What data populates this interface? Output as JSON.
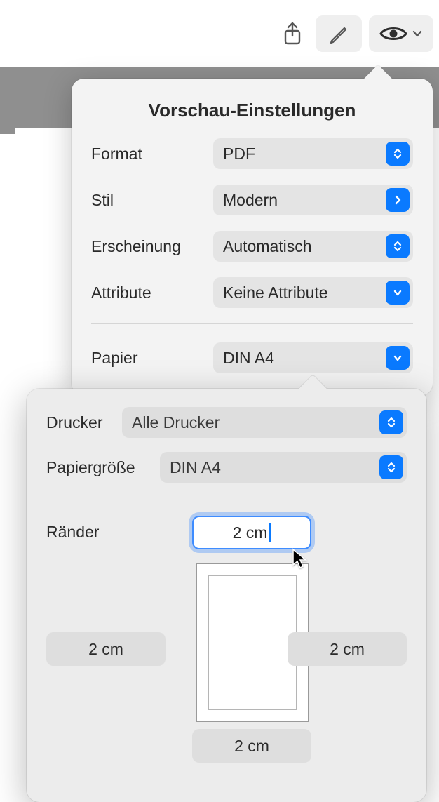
{
  "toolbar": {
    "share_icon": "share-icon",
    "edit_icon": "pencil-icon",
    "preview_icon": "eye-icon"
  },
  "panel": {
    "title": "Vorschau-Einstellungen",
    "rows": {
      "format": {
        "label": "Format",
        "value": "PDF"
      },
      "style": {
        "label": "Stil",
        "value": "Modern"
      },
      "appearance": {
        "label": "Erscheinung",
        "value": "Automatisch"
      },
      "attributes": {
        "label": "Attribute",
        "value": "Keine Attribute"
      },
      "paper": {
        "label": "Papier",
        "value": "DIN A4"
      }
    }
  },
  "paper_popover": {
    "printer": {
      "label": "Drucker",
      "value": "Alle Drucker"
    },
    "papersize": {
      "label": "Papiergröße",
      "value": "DIN A4"
    },
    "margins": {
      "label": "Ränder",
      "top": "2 cm",
      "left": "2 cm",
      "right": "2 cm",
      "bottom": "2 cm"
    }
  },
  "colors": {
    "accent": "#0a7aff",
    "panel_bg": "#f3f3f3",
    "popover_bg": "#ececec",
    "control_bg": "#e4e4e4"
  }
}
